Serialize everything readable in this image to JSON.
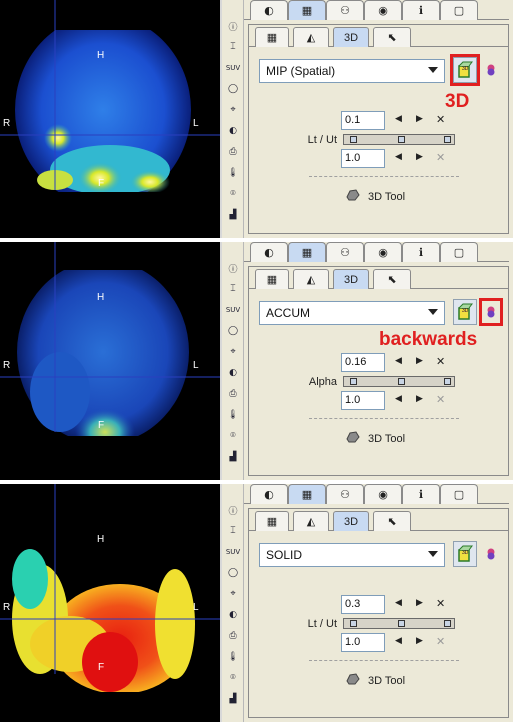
{
  "toolbar_icons": [
    "info-icon",
    "histogram-icon",
    "suv-label",
    "ellipse-roi-icon",
    "crosshair-icon",
    "contrast-icon",
    "print-icon",
    "thermometer-icon",
    "bullseye-icon",
    "bar-chart-icon"
  ],
  "toolbar_suv": "SUV",
  "tabs": [
    "◐",
    "▦",
    "⚇",
    "◉",
    "ℹ",
    "▢"
  ],
  "subtabs": [
    "▦",
    "◭",
    "3D",
    "⬉"
  ],
  "subtab_3d_label": "3D",
  "tool3d_label": "3D Tool",
  "orient": {
    "top": "H",
    "left": "R",
    "right": "L",
    "bottom": "F"
  },
  "panels": [
    {
      "mode": "MIP (Spatial)",
      "value": "0.1",
      "slider_label": "Lt / Ut",
      "value2": "1.0",
      "callout": "3D",
      "callout_target": "3d-render-button",
      "image_style": "mip"
    },
    {
      "mode": "ACCUM",
      "value": "0.16",
      "slider_label": "Alpha",
      "value2": "1.0",
      "callout": "backwards",
      "callout_target": "backwards-button",
      "image_style": "accum"
    },
    {
      "mode": "SOLID",
      "value": "0.3",
      "slider_label": "Lt / Ut",
      "value2": "1.0",
      "callout": "",
      "callout_target": "",
      "image_style": "solid"
    }
  ],
  "colors": {
    "accent_red": "#e02020",
    "active_tab": "#c8daf2",
    "crosshair": "#2a3fbf"
  }
}
